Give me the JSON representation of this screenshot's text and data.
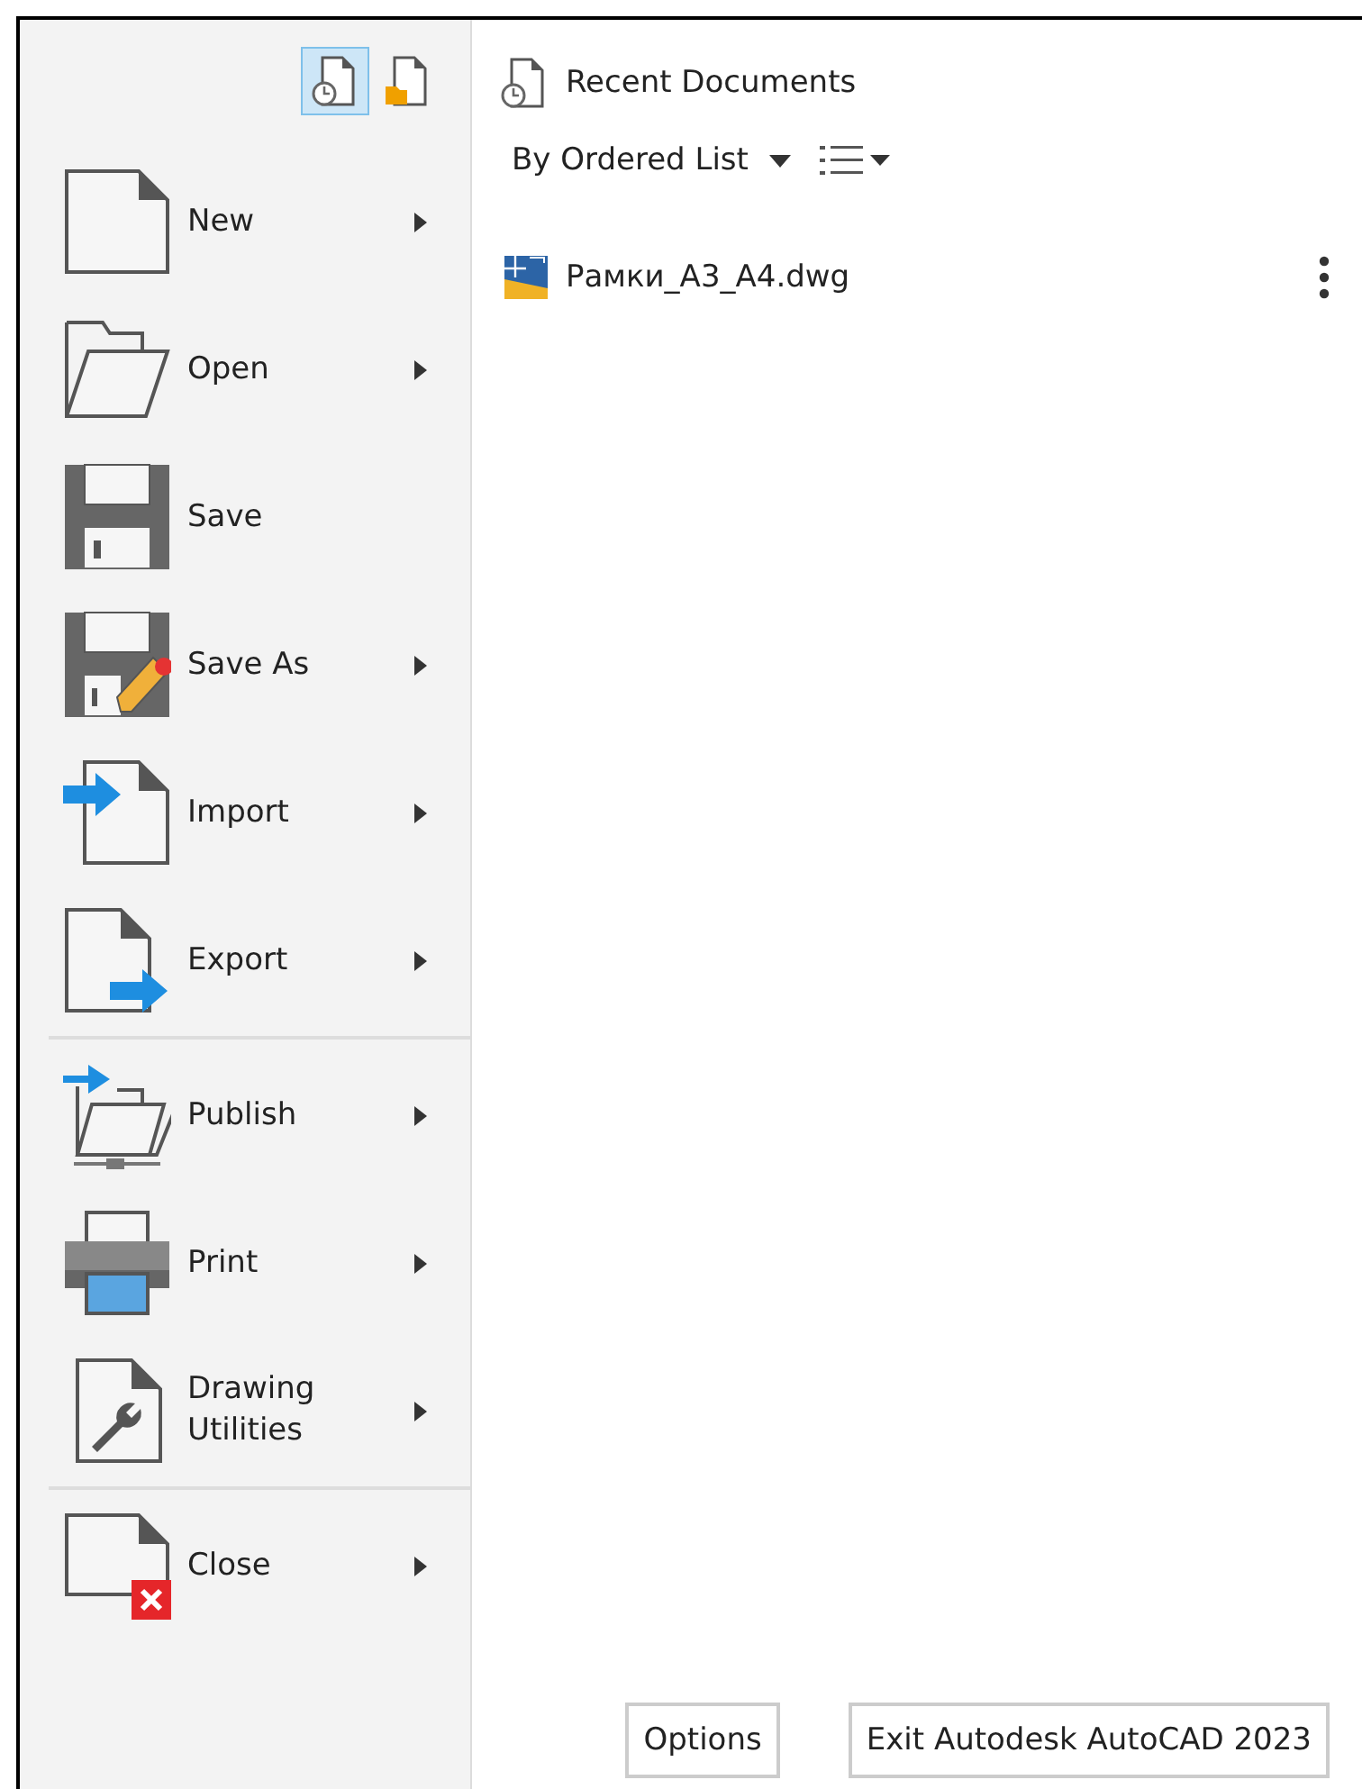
{
  "view_toggles": [
    {
      "kind": "recent",
      "selected": true
    },
    {
      "kind": "open",
      "selected": false
    }
  ],
  "menu_groups": [
    [
      {
        "label": "New",
        "kind": "new",
        "submenu": true
      },
      {
        "label": "Open",
        "kind": "open",
        "submenu": true
      },
      {
        "label": "Save",
        "kind": "save",
        "submenu": false
      },
      {
        "label": "Save As",
        "kind": "saveas",
        "submenu": true
      },
      {
        "label": "Import",
        "kind": "import",
        "submenu": true
      },
      {
        "label": "Export",
        "kind": "export",
        "submenu": true
      }
    ],
    [
      {
        "label": "Publish",
        "kind": "publish",
        "submenu": true
      },
      {
        "label": "Print",
        "kind": "print",
        "submenu": true
      },
      {
        "label": "Drawing Utilities",
        "kind": "utilities",
        "submenu": true
      }
    ],
    [
      {
        "label": "Close",
        "kind": "close",
        "submenu": true
      }
    ]
  ],
  "recent": {
    "title": "Recent Documents",
    "sort": "By Ordered List",
    "files": [
      {
        "name": "Рамки_А3_А4.dwg"
      }
    ]
  },
  "buttons": [
    "Options",
    "Exit Autodesk AutoCAD 2023"
  ]
}
